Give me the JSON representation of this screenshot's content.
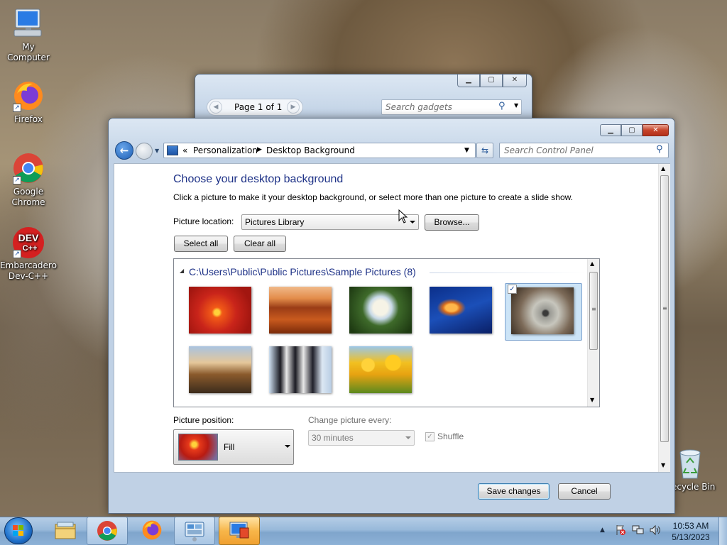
{
  "desktop": {
    "icons": [
      {
        "label": "My Computer",
        "icon": "computer-icon"
      },
      {
        "label": "Firefox",
        "icon": "firefox-icon"
      },
      {
        "label": "Google Chrome",
        "icon": "chrome-icon"
      },
      {
        "label": "Embarcadero Dev-C++",
        "icon": "devcpp-icon"
      },
      {
        "label": "Recycle Bin",
        "icon": "recycle-bin-icon"
      }
    ],
    "devcpp_logo_text": "DEV",
    "devcpp_logo_sub": "C++",
    "recycle_visible_label": "ecycle Bin"
  },
  "gadgets_window": {
    "page_label": "Page 1 of 1",
    "search_placeholder": "Search gadgets"
  },
  "cp_window": {
    "breadcrumb": {
      "chevrons": "«",
      "items": [
        "Personalization",
        "Desktop Background"
      ]
    },
    "search_placeholder": "Search Control Panel",
    "heading": "Choose your desktop background",
    "description": "Click a picture to make it your desktop background, or select more than one picture to create a slide show.",
    "picture_location_label": "Picture location:",
    "picture_location_value": "Pictures Library",
    "browse_label": "Browse...",
    "select_all_label": "Select all",
    "clear_all_label": "Clear all",
    "group_header": "C:\\Users\\Public\\Public Pictures\\Sample Pictures (8)",
    "thumbnails": [
      {
        "name": "Chrysanthemum",
        "selected": false
      },
      {
        "name": "Desert",
        "selected": false
      },
      {
        "name": "Hydrangeas",
        "selected": false
      },
      {
        "name": "Jellyfish",
        "selected": false
      },
      {
        "name": "Koala",
        "selected": true
      },
      {
        "name": "Lighthouse",
        "selected": false
      },
      {
        "name": "Penguins",
        "selected": false
      },
      {
        "name": "Tulips",
        "selected": false
      }
    ],
    "picture_position_label": "Picture position:",
    "picture_position_value": "Fill",
    "change_every_label": "Change picture every:",
    "change_every_value": "30 minutes",
    "shuffle_label": "Shuffle",
    "shuffle_checked": true,
    "save_label": "Save changes",
    "cancel_label": "Cancel"
  },
  "taskbar": {
    "pinned": [
      "windows-explorer-icon",
      "chrome-icon",
      "firefox-icon",
      "gadgets-icon",
      "personalization-icon"
    ],
    "time": "10:53 AM",
    "date": "5/13/2023",
    "tray_icons": [
      "show-hidden-icons",
      "action-center-icon",
      "network-icon",
      "volume-icon"
    ]
  },
  "colors": {
    "heading": "#1e3287",
    "group_header": "#1e3287",
    "selection": "#cce4f7",
    "taskbar": "#8fb2d4"
  }
}
